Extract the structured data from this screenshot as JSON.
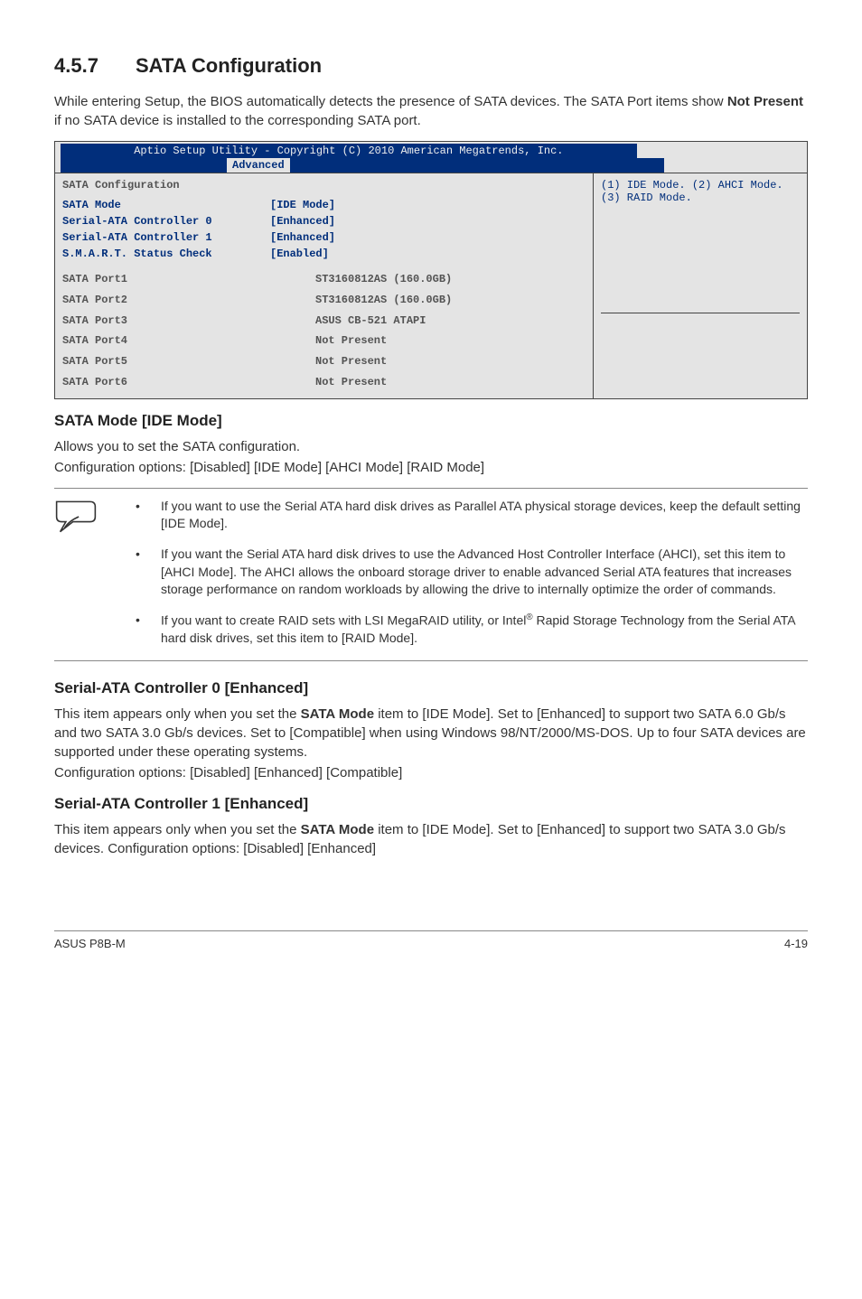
{
  "section": {
    "number": "4.5.7",
    "title": "SATA Configuration"
  },
  "intro": {
    "pre": "While entering Setup, the BIOS automatically detects the presence of SATA devices. The SATA Port items show ",
    "bold": "Not Present",
    "post": " if no SATA device is installed to the corresponding SATA port."
  },
  "bios": {
    "title_pre": "Aptio Setup Utility - Copyright (C) 2010 American Megatrends, Inc.",
    "tab": "Advanced",
    "heading": "SATA Configuration",
    "help1": "(1) IDE Mode. (2) AHCI Mode.",
    "help2": "(3) RAID Mode.",
    "rows": [
      {
        "lbl": "SATA Mode",
        "val": "[IDE Mode]"
      },
      {
        "lbl": "Serial-ATA Controller 0",
        "val": "[Enhanced]"
      },
      {
        "lbl": "Serial-ATA Controller 1",
        "val": "[Enhanced]"
      },
      {
        "lbl": "S.M.A.R.T. Status Check",
        "val": "[Enabled]"
      }
    ],
    "ports": [
      {
        "lbl": "SATA Port1",
        "val": "ST3160812AS (160.0GB)"
      },
      {
        "lbl": "SATA Port2",
        "val": "ST3160812AS (160.0GB)"
      },
      {
        "lbl": "SATA Port3",
        "val": "ASUS CB-521 ATAPI"
      },
      {
        "lbl": "SATA Port4",
        "val": "Not Present"
      },
      {
        "lbl": "SATA Port5",
        "val": "Not Present"
      },
      {
        "lbl": "SATA Port6",
        "val": "Not Present"
      }
    ]
  },
  "sata_mode": {
    "heading": "SATA Mode [IDE Mode]",
    "line1": "Allows you to set the SATA configuration.",
    "line2": "Configuration options: [Disabled] [IDE Mode] [AHCI Mode] [RAID Mode]"
  },
  "notes": {
    "item1": "If you want to use the Serial ATA hard disk drives as Parallel ATA physical storage devices, keep the default setting [IDE Mode].",
    "item2": "If you want the Serial ATA hard disk drives to use the Advanced Host Controller Interface (AHCI), set this item to [AHCI Mode]. The AHCI allows the onboard storage driver to enable advanced Serial ATA features that increases storage performance on random workloads by allowing the drive to internally optimize the order of commands.",
    "item3_pre": "If you want to create RAID sets with LSI MegaRAID utility, or Intel",
    "item3_sup": "®",
    "item3_post": " Rapid Storage Technology from the Serial ATA hard disk drives, set this item to [RAID Mode]."
  },
  "ctrl0": {
    "heading": "Serial-ATA Controller 0 [Enhanced]",
    "p_pre": "This item appears only when you set the ",
    "p_bold": "SATA Mode",
    "p_post": " item to [IDE Mode]. Set to [Enhanced] to support two SATA 6.0 Gb/s and two SATA 3.0 Gb/s devices. Set to [Compatible] when using Windows 98/NT/2000/MS-DOS. Up to four SATA devices are supported under these operating systems.",
    "opts": "Configuration options: [Disabled] [Enhanced] [Compatible]"
  },
  "ctrl1": {
    "heading": "Serial-ATA Controller 1 [Enhanced]",
    "p_pre": "This item appears only when you set the ",
    "p_bold": "SATA Mode",
    "p_post": " item to [IDE Mode]. Set to [Enhanced] to support two SATA 3.0 Gb/s devices. Configuration options: [Disabled] [Enhanced]"
  },
  "footer": {
    "left": "ASUS P8B-M",
    "right": "4-19"
  }
}
